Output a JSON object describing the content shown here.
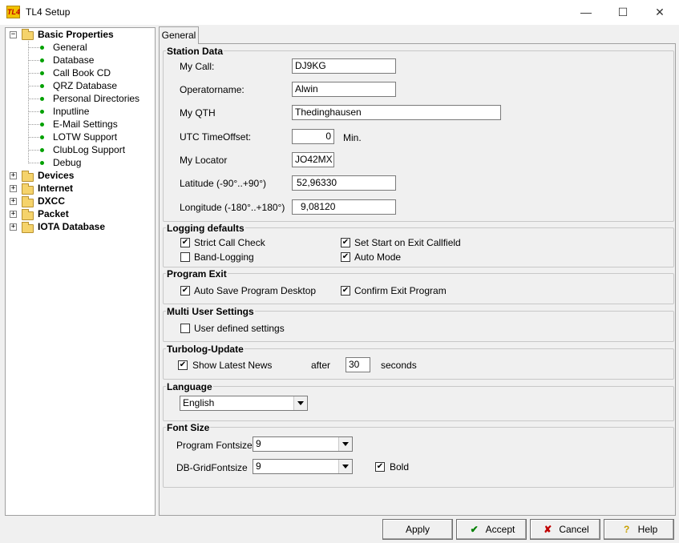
{
  "window": {
    "title": "TL4 Setup",
    "app_icon_text": "TL4"
  },
  "tree": {
    "root": {
      "label": "Basic Properties",
      "expander": "−"
    },
    "children": [
      "General",
      "Database",
      "Call Book CD",
      "QRZ Database",
      "Personal Directories",
      "Inputline",
      "E-Mail Settings",
      "LOTW Support",
      "ClubLog Support",
      "Debug"
    ],
    "folders": [
      {
        "label": "Devices",
        "expander": "+"
      },
      {
        "label": "Internet",
        "expander": "+"
      },
      {
        "label": "DXCC",
        "expander": "+"
      },
      {
        "label": "Packet",
        "expander": "+"
      },
      {
        "label": "IOTA Database",
        "expander": "+"
      }
    ]
  },
  "tab": {
    "label": "General"
  },
  "station": {
    "title": "Station Data",
    "my_call_label": "My Call:",
    "my_call": "DJ9KG",
    "operator_label": "Operatorname:",
    "operator": "Alwin",
    "qth_label": "My QTH",
    "qth": "Thedinghausen",
    "utc_label": "UTC TimeOffset:",
    "utc": "0",
    "utc_unit": "Min.",
    "locator_label": "My Locator",
    "locator": "JO42MX",
    "lat_label": "Latitude (-90°..+90°)",
    "lat": "52,96330",
    "lon_label": "Longitude (-180°..+180°)",
    "lon": "9,08120"
  },
  "logging": {
    "title": "Logging defaults",
    "strict": "Strict Call Check",
    "strict_checked": true,
    "setstart": "Set Start on Exit Callfield",
    "setstart_checked": true,
    "band": "Band-Logging",
    "band_checked": false,
    "auto": "Auto Mode",
    "auto_checked": true
  },
  "exit": {
    "title": "Program Exit",
    "autosave": "Auto Save Program Desktop",
    "autosave_checked": true,
    "confirm": "Confirm Exit Program",
    "confirm_checked": true
  },
  "multi": {
    "title": "Multi User Settings",
    "user": "User defined settings",
    "user_checked": false
  },
  "update": {
    "title": "Turbolog-Update",
    "news": "Show Latest News",
    "news_checked": true,
    "after": "after",
    "seconds_value": "30",
    "seconds": "seconds"
  },
  "language": {
    "title": "Language",
    "value": "English"
  },
  "font": {
    "title": "Font Size",
    "program_label": "Program Fontsize",
    "program_value": "9",
    "grid_label": "DB-GridFontsize",
    "grid_value": "9",
    "bold": "Bold",
    "bold_checked": true
  },
  "buttons": {
    "apply": "Apply",
    "accept": "Accept",
    "cancel": "Cancel",
    "help": "Help"
  },
  "colors": {
    "check_green": "#008000",
    "cancel_red": "#c00000",
    "help_yellow": "#f5d000"
  }
}
